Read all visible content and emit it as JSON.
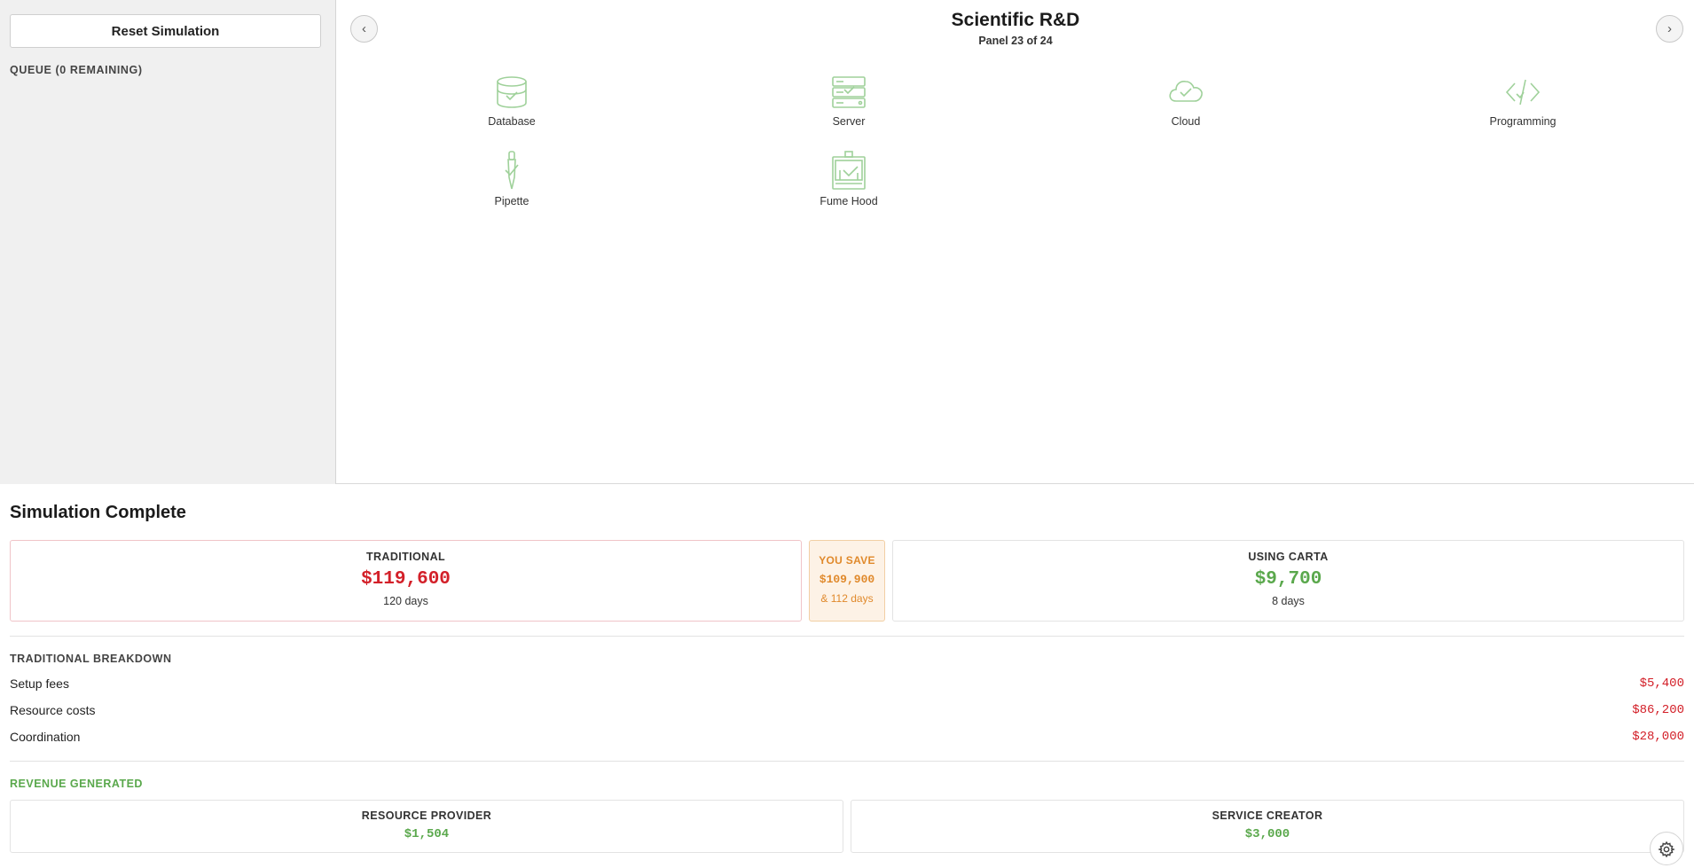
{
  "sidebar": {
    "reset_label": "Reset Simulation",
    "queue_label": "QUEUE (0 REMAINING)"
  },
  "panel": {
    "title": "Scientific R&D",
    "subtitle": "Panel 23 of 24",
    "prev_icon": "‹",
    "next_icon": "›",
    "resources": [
      {
        "label": "Database",
        "icon": "database-icon"
      },
      {
        "label": "Server",
        "icon": "server-icon"
      },
      {
        "label": "Cloud",
        "icon": "cloud-icon"
      },
      {
        "label": "Programming",
        "icon": "code-icon"
      },
      {
        "label": "Pipette",
        "icon": "pipette-icon"
      },
      {
        "label": "Fume Hood",
        "icon": "fume-hood-icon"
      }
    ],
    "icon_color": "#9fd19a"
  },
  "results": {
    "title": "Simulation Complete",
    "traditional": {
      "label": "TRADITIONAL",
      "value": "$119,600",
      "days": "120 days"
    },
    "savings": {
      "label": "YOU SAVE",
      "value": "$109,900",
      "days": "& 112 days"
    },
    "carta": {
      "label": "USING CARTA",
      "value": "$9,700",
      "days": "8 days"
    },
    "breakdown": {
      "label": "TRADITIONAL BREAKDOWN",
      "rows": [
        {
          "label": "Setup fees",
          "value": "$5,400"
        },
        {
          "label": "Resource costs",
          "value": "$86,200"
        },
        {
          "label": "Coordination",
          "value": "$28,000"
        }
      ]
    },
    "revenue": {
      "label": "REVENUE GENERATED",
      "provider": {
        "label": "RESOURCE PROVIDER",
        "value": "$1,504"
      },
      "creator": {
        "label": "SERVICE CREATOR",
        "value": "$3,000"
      }
    }
  },
  "colors": {
    "red": "#d32029",
    "green": "#5aa84c",
    "orange": "#e0892b"
  }
}
